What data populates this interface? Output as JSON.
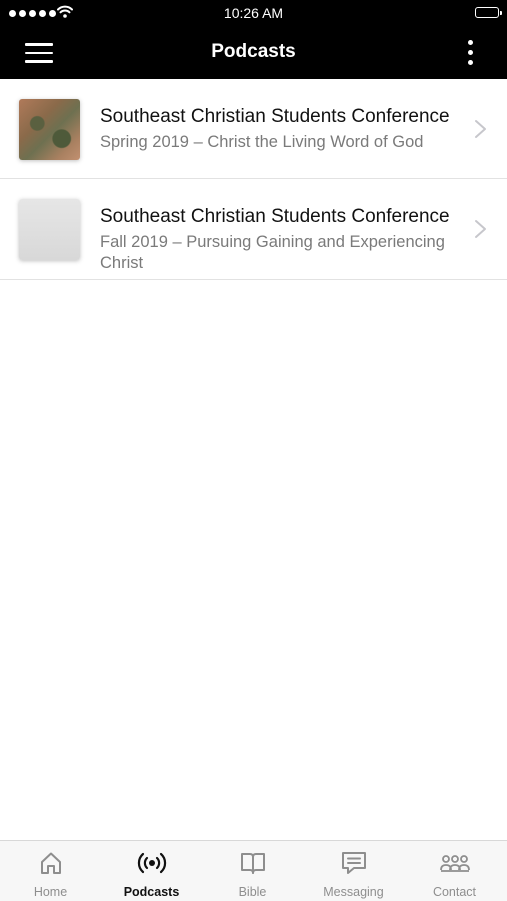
{
  "status_bar": {
    "time": "10:26 AM"
  },
  "nav": {
    "title": "Podcasts"
  },
  "podcasts": [
    {
      "title": "Southeast Christian Students Conference",
      "subtitle": "Spring 2019 – Christ the Living Word of God"
    },
    {
      "title": "Southeast Christian Students Conference",
      "subtitle": "Fall 2019 – Pursuing Gaining and Experiencing Christ"
    }
  ],
  "tabs": [
    {
      "label": "Home",
      "icon": "home-icon",
      "active": false
    },
    {
      "label": "Podcasts",
      "icon": "broadcast-icon",
      "active": true
    },
    {
      "label": "Bible",
      "icon": "book-icon",
      "active": false
    },
    {
      "label": "Messaging",
      "icon": "message-icon",
      "active": false
    },
    {
      "label": "Contact",
      "icon": "people-icon",
      "active": false
    }
  ],
  "colors": {
    "bar_background": "#000000",
    "tab_active": "#111111",
    "tab_inactive": "#8e8e8e"
  }
}
